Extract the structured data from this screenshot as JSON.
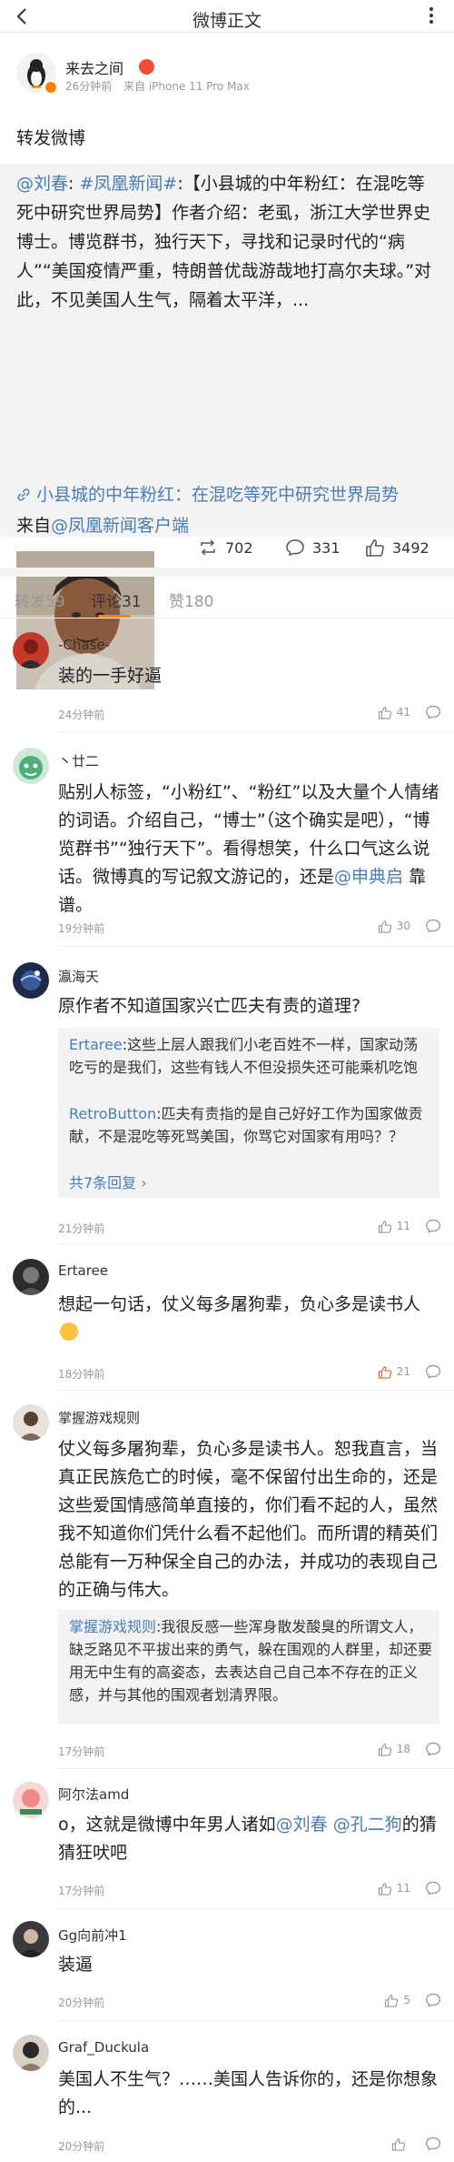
{
  "nav": {
    "title": "微博正文",
    "back_icon": "back-arrow-icon",
    "more_icon": "more-dots-icon"
  },
  "post": {
    "author": "来去之间",
    "time": "26分钟前",
    "source": "来自 iPhone 11 Pro Max",
    "text": "转发微博"
  },
  "quote": {
    "mention": "@刘春",
    "topic": "#凤凰新闻#",
    "body": ":【小县城的中年粉红：在混吃等死中研究世界局势】作者介绍：老虱，浙江大学世界史博士。博览群书，独行天下，寻找和记录时代的“病人”“美国疫情严重，特朗普优哉游哉地打高尔夫球。”对此，不见美国人生气，隔着太平洋，...",
    "link_text": "小县城的中年粉红：在混吃等死中研究世界局势",
    "from_prefix": "来自",
    "from_link": "@凤凰新闻客户端"
  },
  "stats": {
    "reposts": "702",
    "comments": "331",
    "likes": "3492"
  },
  "tabs": [
    {
      "label": "转发59"
    },
    {
      "label": "评论31"
    },
    {
      "label": "赞180"
    }
  ],
  "comments": [
    {
      "name": "-Chase-",
      "text": "装的一手好逼",
      "time": "24分钟前",
      "likes": "41"
    },
    {
      "name": "丶廿二",
      "text_a": "贴别人标签，“小粉红”、“粉红”以及大量个人情绪的词语。介绍自己，“博士”（这个确实是吧），“博览群书”“独行天下”。看得想笑，什么口气这么说话。微博真的写记叙文游记的，还是",
      "mention": "@申典启",
      "text_b": " 靠谱。",
      "time": "19分钟前",
      "likes": "30"
    },
    {
      "name": "瀛海天",
      "text": "原作者不知道国家兴亡匹夫有责的道理?",
      "time": "21分钟前",
      "likes": "11",
      "replies": [
        {
          "user": "Ertaree",
          "text": ":这些上层人跟我们小老百姓不一样，国家动荡吃亏的是我们，这些有钱人不但没损失还可能乘机吃饱"
        },
        {
          "user": "RetroButton",
          "text": ":匹夫有责指的是自己好好工作为国家做贡献，不是混吃等死骂美国，你骂它对国家有用吗？？"
        }
      ],
      "more_replies": "共7条回复"
    },
    {
      "name": "Ertaree",
      "text": "想起一句话，仗义每多屠狗辈，负心多是读书人",
      "time": "18分钟前",
      "likes": "21"
    },
    {
      "name": "掌握游戏规则",
      "text": "仗义每多屠狗辈，负心多是读书人。恕我直言，当真正民族危亡的时候，毫不保留付出生命的，还是这些爱国情感简单直接的，你们看不起的人，虽然我不知道你们凭什么看不起他们。而所谓的精英们总能有一万种保全自己的办法，并成功的表现自己的正确与伟大。",
      "time": "17分钟前",
      "likes": "18",
      "replies": [
        {
          "user": "掌握游戏规则",
          "text": ":我很反感一些浑身散发酸臭的所谓文人，缺乏路见不平拔出来的勇气，躲在围观的人群里，却还要用无中生有的高姿态，去表达自己自己本不存在的正义感，并与其他的围观者划清界限。"
        }
      ]
    },
    {
      "name": "阿尔法amd",
      "text_a": "o，这就是微博中年男人诸如",
      "mention": "@刘春",
      "mention2": "@孔二狗",
      "text_b": "的猜猜狂吠吧",
      "time": "17分钟前",
      "likes": "11"
    },
    {
      "name": "Gg向前冲1",
      "text": "装逼",
      "time": "20分钟前",
      "likes": "5"
    },
    {
      "name": "Graf_Duckula",
      "text": "美国人不生气？……美国人告诉你的，还是你想象的...",
      "time": "20分钟前",
      "likes": ""
    }
  ],
  "colors": {
    "link": "#4a7db4",
    "accent": "#ff8200",
    "liked": "#e0604a"
  }
}
